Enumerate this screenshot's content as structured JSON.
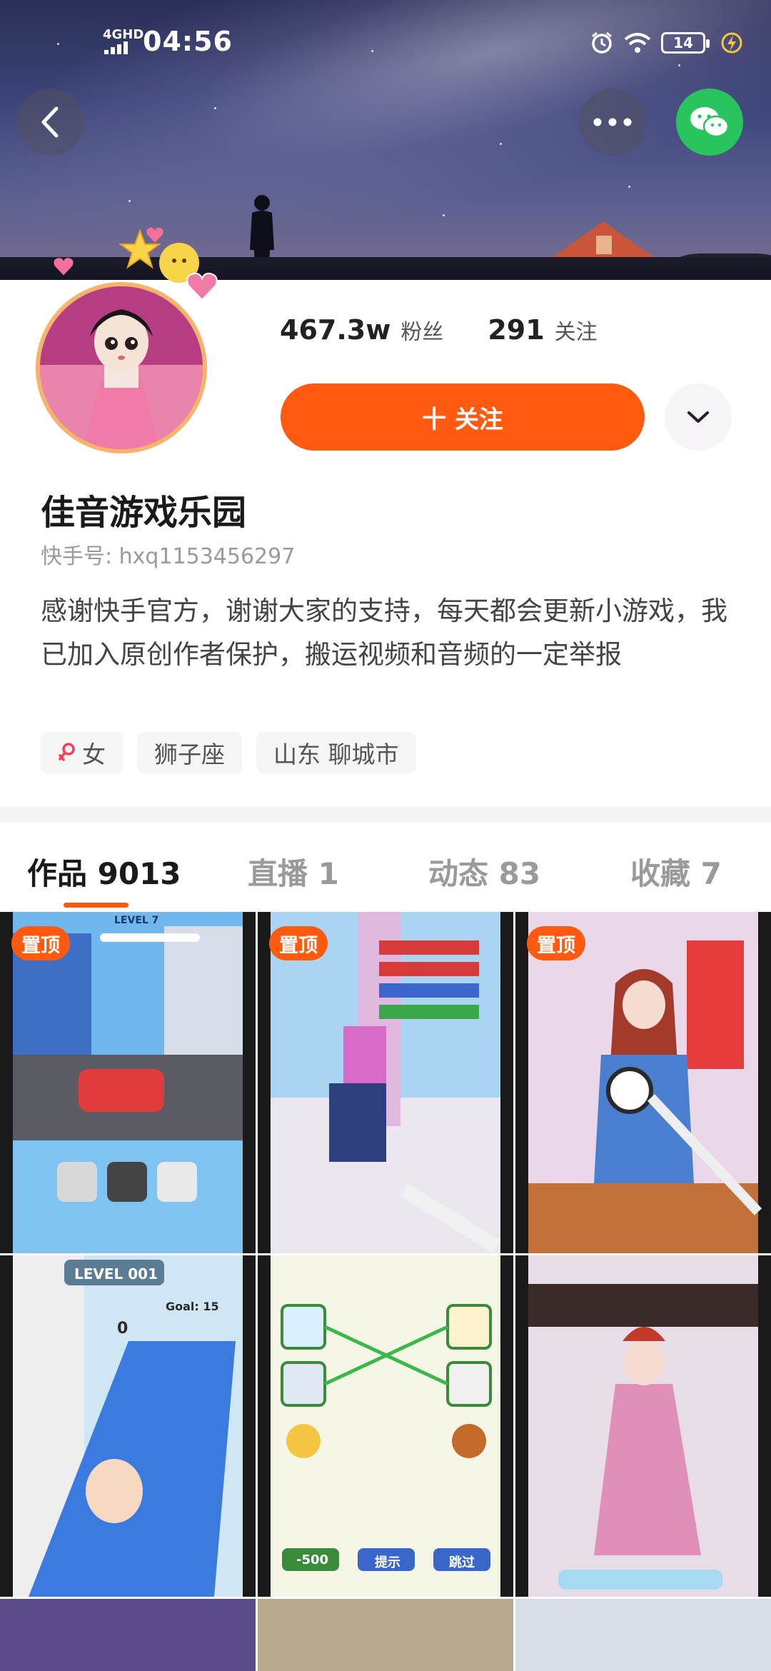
{
  "status_bar": {
    "network": "4GHD",
    "time": "04:56",
    "battery": "14",
    "icons": [
      "alarm-icon",
      "wifi-icon",
      "battery-icon",
      "charging-icon"
    ]
  },
  "nav": {
    "back_icon": "chevron-left-icon",
    "more_icon": "more-dots-icon",
    "share_icon": "wechat-icon"
  },
  "profile": {
    "fans_count": "467.3w",
    "fans_label": "粉丝",
    "following_count": "291",
    "following_label": "关注",
    "follow_button": "十 关注",
    "name": "佳音游戏乐园",
    "kuaishou_id": "快手号: hxq1153456297",
    "bio": "感谢快手官方，谢谢大家的支持，每天都会更新小游戏，我已加入原创作者保护，搬运视频和音频的一定举报",
    "tags": [
      {
        "icon": "female-icon",
        "label": "女"
      },
      {
        "label": "狮子座"
      },
      {
        "label": "山东 聊城市"
      }
    ]
  },
  "tabs": [
    {
      "label": "作品 9013",
      "active": true
    },
    {
      "label": "直播 1",
      "active": false
    },
    {
      "label": "动态 83",
      "active": false
    },
    {
      "label": "收藏 7",
      "active": false
    }
  ],
  "videos": [
    {
      "pinned": "置顶",
      "level": "LEVEL 7"
    },
    {
      "pinned": "置顶"
    },
    {
      "pinned": "置顶"
    },
    {
      "level": "LEVEL 001",
      "goal": "Goal: 15",
      "score": "0"
    },
    {
      "buttons": [
        "-500",
        "提示",
        "跳过"
      ]
    },
    {}
  ],
  "colors": {
    "accent": "#ff5a0f",
    "wechat": "#2ac45e"
  }
}
